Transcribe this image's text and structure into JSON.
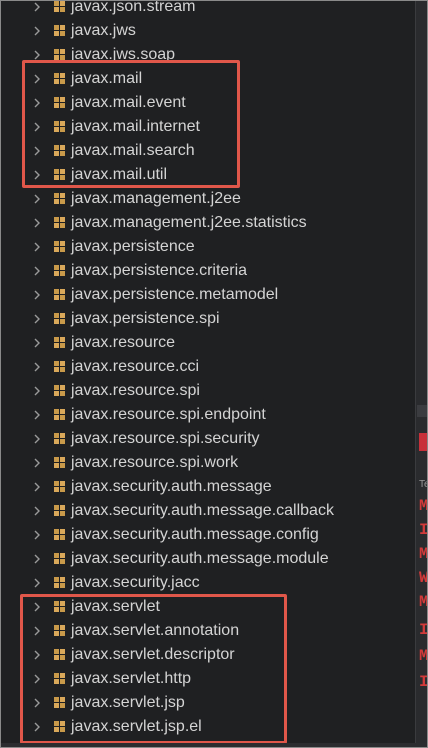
{
  "tree": {
    "items": [
      {
        "label": "javax.json.stream"
      },
      {
        "label": "javax.jws"
      },
      {
        "label": "javax.jws.soap"
      },
      {
        "label": "javax.mail"
      },
      {
        "label": "javax.mail.event"
      },
      {
        "label": "javax.mail.internet"
      },
      {
        "label": "javax.mail.search"
      },
      {
        "label": "javax.mail.util"
      },
      {
        "label": "javax.management.j2ee"
      },
      {
        "label": "javax.management.j2ee.statistics"
      },
      {
        "label": "javax.persistence"
      },
      {
        "label": "javax.persistence.criteria"
      },
      {
        "label": "javax.persistence.metamodel"
      },
      {
        "label": "javax.persistence.spi"
      },
      {
        "label": "javax.resource"
      },
      {
        "label": "javax.resource.cci"
      },
      {
        "label": "javax.resource.spi"
      },
      {
        "label": "javax.resource.spi.endpoint"
      },
      {
        "label": "javax.resource.spi.security"
      },
      {
        "label": "javax.resource.spi.work"
      },
      {
        "label": "javax.security.auth.message"
      },
      {
        "label": "javax.security.auth.message.callback"
      },
      {
        "label": "javax.security.auth.message.config"
      },
      {
        "label": "javax.security.auth.message.module"
      },
      {
        "label": "javax.security.jacc"
      },
      {
        "label": "javax.servlet"
      },
      {
        "label": "javax.servlet.annotation"
      },
      {
        "label": "javax.servlet.descriptor"
      },
      {
        "label": "javax.servlet.http"
      },
      {
        "label": "javax.servlet.jsp"
      },
      {
        "label": "javax.servlet.jsp.el"
      }
    ]
  },
  "right_pane": {
    "letters": [
      "M",
      "I",
      "M",
      "W",
      "M",
      "I",
      "M",
      "I"
    ],
    "small": "Te"
  },
  "colors": {
    "highlight": "#e0574a",
    "text": "#d4d4d4",
    "background": "#1f2022",
    "error_red": "#d23a3a"
  }
}
